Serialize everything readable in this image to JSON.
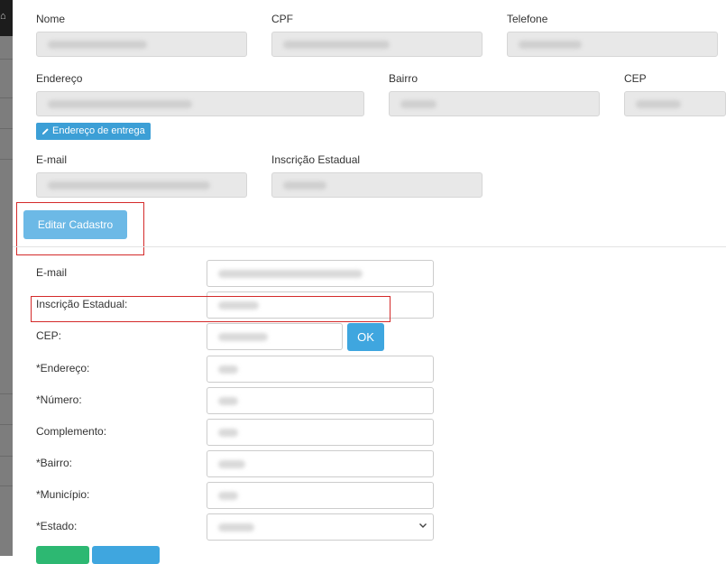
{
  "top_form": {
    "labels": {
      "nome": "Nome",
      "cpf": "CPF",
      "telefone": "Telefone",
      "endereco": "Endereço",
      "bairro": "Bairro",
      "cep": "CEP",
      "email": "E-mail",
      "inscricao": "Inscrição Estadual"
    },
    "delivery_address_button": "Endereço de entrega",
    "edit_button": "Editar Cadastro"
  },
  "edit_form": {
    "labels": {
      "email": "E-mail",
      "inscricao": "Inscrição Estadual:",
      "cep": "CEP:",
      "endereco": "*Endereço:",
      "numero": "*Número:",
      "complemento": "Complemento:",
      "bairro": "*Bairro:",
      "municipio": "*Município:",
      "estado": "*Estado:"
    },
    "ok_button": "OK"
  },
  "colors": {
    "accent_blue": "#3fa6df",
    "highlight_red": "#d42a2a",
    "save_green": "#2db872"
  },
  "icons": {
    "home": "home-icon",
    "pencil": "pencil-icon",
    "select_arrow": "chevron-down-icon"
  }
}
